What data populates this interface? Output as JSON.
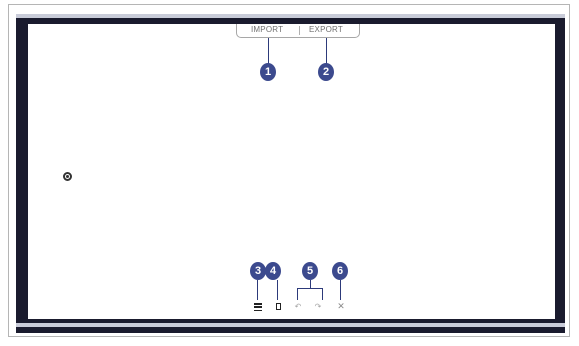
{
  "tab": {
    "import_label": "IMPORT",
    "export_label": "EXPORT"
  },
  "callouts": {
    "c1": "1",
    "c2": "2",
    "c3": "3",
    "c4": "4",
    "c5": "5",
    "c6": "6"
  },
  "toolbar": {
    "undo_glyph": "↶",
    "redo_glyph": "↷",
    "close_glyph": "✕"
  },
  "icons": {
    "float": "settings-icon",
    "menu": "menu-icon",
    "page": "page-icon",
    "undo": "undo-icon",
    "redo": "redo-icon",
    "close": "close-icon"
  },
  "colors": {
    "bezel": "#1a1b2e",
    "bezel_edge": "#c9ccd9",
    "callout": "#3c4a8e"
  }
}
